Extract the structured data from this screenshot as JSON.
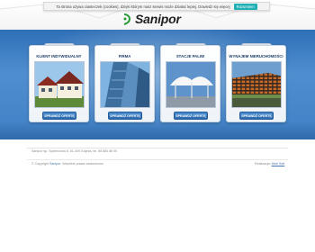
{
  "header": {
    "logo_text": "Sanipor",
    "cookie_text": "Ta strona używa ciasteczek (cookies), dzięki którym nasz serwis może działać lepiej. Dowiedz się więcej",
    "cookie_button": "Rozumiem"
  },
  "cards": [
    {
      "tab": "Oferta",
      "title": "KLIENT INDYWIDUALNY",
      "button": "SPRAWDŹ OFERTĘ"
    },
    {
      "tab": "Oferta",
      "title": "FIRMA",
      "button": "SPRAWDŹ OFERTĘ"
    },
    {
      "tab": "Oferta",
      "title": "STACJE PALIW",
      "button": "SPRAWDŹ OFERTĘ"
    },
    {
      "tab": "Oferta",
      "title": "WYNAJEM NIERUCHOMOŚCI",
      "button": "SPRAWDŹ OFERTĘ"
    }
  ],
  "footer": {
    "address": "Sanipor sp. Spichrzowa 8, 81-409 Gdynia, tel. 58 660 86 00",
    "copyright_prefix": "© Copyright",
    "copyright_link": "Sanipor",
    "copyright_suffix": ". Wszelkie prawa zastrzeżone.",
    "realizacja_label": "Realizacja:",
    "realizacja_link": "Web Soft"
  }
}
